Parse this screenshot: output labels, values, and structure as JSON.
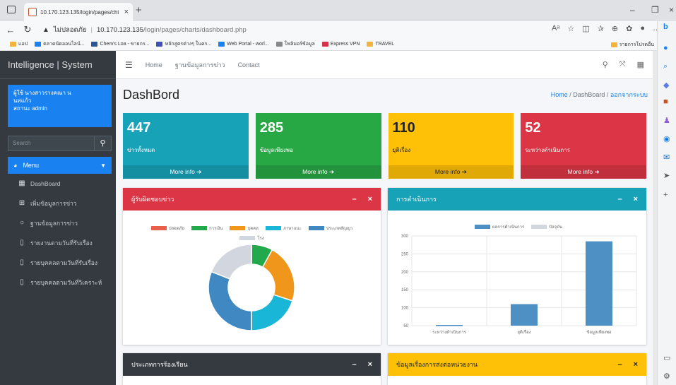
{
  "browser": {
    "tab_title": "10.170.123.135/login/pages/chi",
    "address_warning": "ไม่ปลอดภัย",
    "address_host": "10.170.123.135",
    "address_path": "/login/pages/charts/dashboard.php",
    "bookmarks": [
      {
        "label": "แอป",
        "color": "#f2b43c"
      },
      {
        "label": "ตลาดนัดออนไลน์...",
        "color": "#1a82f0"
      },
      {
        "label": "Chem's Loa - ขายกร...",
        "color": "#2b5797"
      },
      {
        "label": "หลักสูตรต่างๆ ในคร...",
        "color": "#3f51b5"
      },
      {
        "label": "Web Portal - worl...",
        "color": "#1a82f0"
      },
      {
        "label": "โพลิมอร์ข้อมูล",
        "color": "#888888"
      },
      {
        "label": "Express VPN",
        "color": "#d9304a"
      },
      {
        "label": "TRAVEL",
        "color": "#f2b43c"
      }
    ],
    "bookmark_right": "รายการโปรดอื่น"
  },
  "sidebar": {
    "brand": "Intelligence | System",
    "user_line1": "ผู้ใช้ นางสาวรางคณา น",
    "user_line2": "นทแก้ว",
    "user_line3": "สถานะ admin",
    "search_placeholder": "Search",
    "menu_label": "Menu",
    "items": [
      {
        "label": "DashBoard"
      },
      {
        "label": "เพิ่มข้อมูลการข่าว"
      },
      {
        "label": "ฐานข้อมูลการข่าว"
      },
      {
        "label": "รายงานตามวันที่รับเรื่อง"
      },
      {
        "label": "รายบุคคลตามวันที่รับเรื่อง"
      },
      {
        "label": "รายบุคคลตามวันที่วิเคราะห์"
      }
    ]
  },
  "topnav": {
    "home": "Home",
    "database": "ฐานข้อมูลการข่าว",
    "contact": "Contact"
  },
  "page": {
    "title": "DashBord",
    "crumb_home": "Home",
    "crumb_current": "DashBoard",
    "crumb_logout": "ออกจากระบบ"
  },
  "stats": [
    {
      "value": "447",
      "label": "ข่าวทั้งหมด",
      "more": "More info",
      "color": "#17a2b8"
    },
    {
      "value": "285",
      "label": "ข้อมูลเพียงพอ",
      "more": "More info",
      "color": "#28a745"
    },
    {
      "value": "110",
      "label": "ยุติเรื่อง",
      "more": "More info",
      "color": "#ffc107"
    },
    {
      "value": "52",
      "label": "ระหว่างดำเนินการ",
      "more": "More info",
      "color": "#dc3545"
    }
  ],
  "cards": {
    "donut_title": "ผู้รับผิดชอบข่าว",
    "bar_title": "การดำเนินการ",
    "bottom_left_title": "ประเภทการร้องเรียน",
    "bottom_right_title": "ข้อมูลเรื่องการส่งต่อหน่วยงาน",
    "minus": "–",
    "close": "×",
    "colors": {
      "red": "#dc3545",
      "teal": "#17a2b8",
      "dark": "#343a40",
      "yellow": "#ffc107"
    }
  },
  "chart_data": [
    {
      "type": "pie",
      "title": "",
      "categories": [
        "ปลอดภัย",
        "การเงิน",
        "บุคคล",
        "ภาษาแนะ",
        "ประเภทสัญญา",
        "โรง"
      ],
      "colors": [
        "#e8604c",
        "#22a94b",
        "#f0961a",
        "#19b6d8",
        "#3f88c1",
        "#d2d6de"
      ],
      "values": [
        0,
        8,
        22,
        20,
        31,
        19
      ]
    },
    {
      "type": "bar",
      "title": "",
      "legend": [
        "ผลการดำเนินการ",
        "ปัจจุบัน"
      ],
      "legend_colors": [
        "#4e8fc4",
        "#d2d6de"
      ],
      "categories": [
        "ระหว่างดำเนินการ",
        "ยุติเรื่อง",
        "ข้อมูลเพียงพอ"
      ],
      "values": [
        52,
        110,
        285
      ],
      "ylim": [
        50,
        300
      ],
      "yticks": [
        50,
        100,
        150,
        200,
        250,
        300
      ],
      "bar_color": "#4e8fc4"
    }
  ]
}
